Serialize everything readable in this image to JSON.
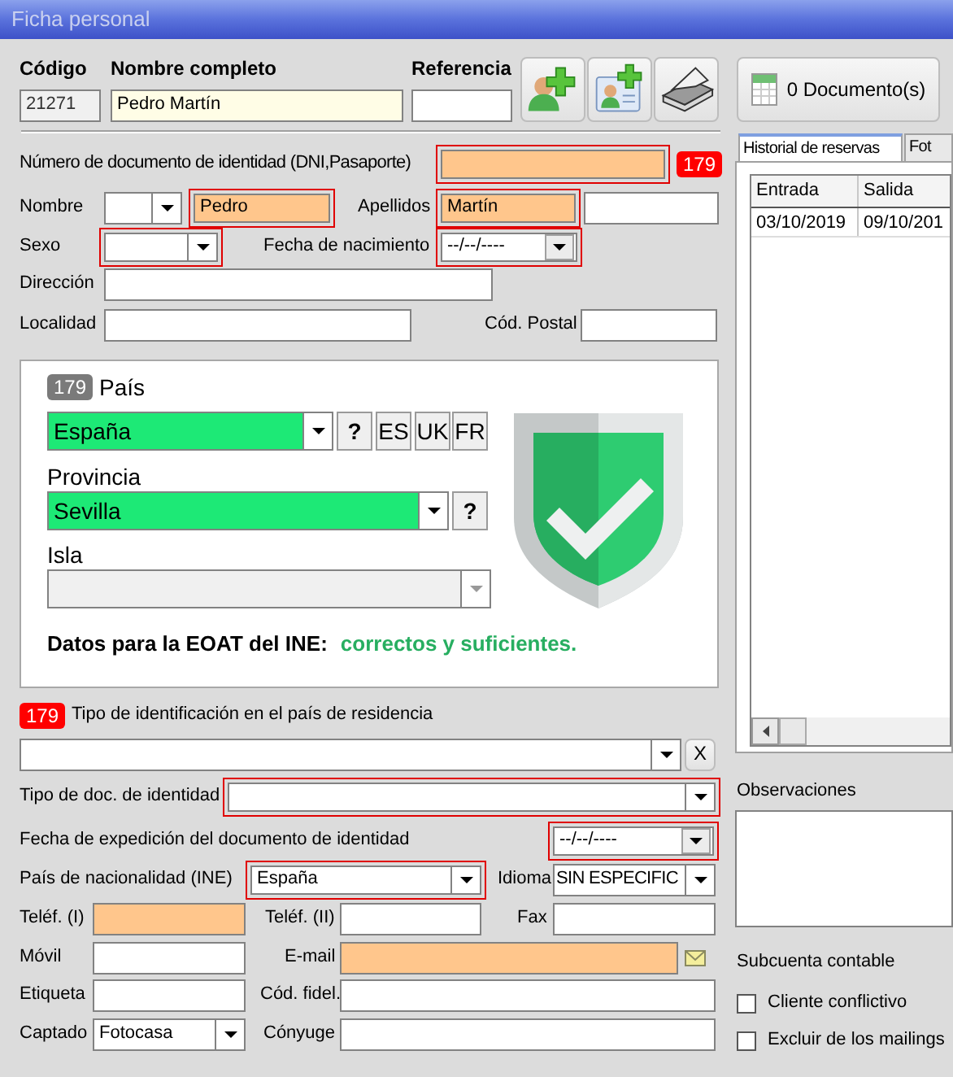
{
  "window": {
    "title": "Ficha personal"
  },
  "header": {
    "code": {
      "label": "Código",
      "value": "21271",
      "disabled": true
    },
    "full_name": {
      "label": "Nombre completo",
      "value": "Pedro Martín"
    },
    "reference": {
      "label": "Referencia"
    }
  },
  "documents_button": {
    "label": "0 Documento(s)"
  },
  "id_number": {
    "label": "Número de documento de identidad (DNI,Pasaporte)",
    "highlighted": true,
    "error": true,
    "badge": {
      "text": "179",
      "color": "#ff0000"
    }
  },
  "first_name": {
    "label": "Nombre",
    "value": "Pedro",
    "highlighted": true,
    "error": true
  },
  "surname": {
    "label": "Apellidos",
    "value": "Martín",
    "highlighted": true,
    "error": true
  },
  "sex": {
    "label": "Sexo",
    "error": true
  },
  "birth_date": {
    "label": "Fecha de nacimiento",
    "value": "--/--/----",
    "error": true
  },
  "address": {
    "label": "Dirección"
  },
  "city": {
    "label": "Localidad"
  },
  "postal_code": {
    "label": "Cód. Postal"
  },
  "location_panel": {
    "badge": {
      "text": "179",
      "color": "#7a7a7a"
    },
    "country": {
      "label": "País",
      "value": "España",
      "valid": true
    },
    "country_buttons": [
      "?",
      "ES",
      "UK",
      "FR"
    ],
    "province": {
      "label": "Provincia",
      "value": "Sevilla",
      "valid": true
    },
    "province_button": "?",
    "island": {
      "label": "Isla",
      "disabled": true
    },
    "eoat_label": "Datos para la EOAT del INE:",
    "eoat_status": "correctos y suficientes."
  },
  "residence_id": {
    "badge": {
      "text": "179",
      "color": "#ff0000"
    },
    "label": "Tipo de identificación en el país de residencia",
    "clear_button": "X"
  },
  "doc_type": {
    "label": "Tipo de doc. de identidad",
    "error": true
  },
  "issue_date": {
    "label": "Fecha de expedición del documento de identidad",
    "value": "--/--/----",
    "error": true
  },
  "nationality": {
    "label": "País de nacionalidad (INE)",
    "value": "España",
    "error": true
  },
  "language": {
    "label": "Idioma",
    "value": "SIN ESPECIFIC"
  },
  "phone_1": {
    "label": "Teléf. (I)",
    "highlighted": true
  },
  "phone_2": {
    "label": "Teléf. (II)"
  },
  "fax": {
    "label": "Fax"
  },
  "mobile": {
    "label": "Móvil"
  },
  "email": {
    "label": "E-mail",
    "highlighted": true
  },
  "tag": {
    "label": "Etiqueta"
  },
  "loyalty_code": {
    "label": "Cód. fidel."
  },
  "source": {
    "label": "Captado",
    "value": "Fotocasa"
  },
  "spouse": {
    "label": "Cónyuge"
  },
  "tabs": [
    {
      "label": "Historial de reservas",
      "selected": true
    },
    {
      "label": "Fot",
      "selected": false
    }
  ],
  "bookings": {
    "columns": [
      "Entrada",
      "Salida"
    ],
    "rows": [
      [
        "03/10/2019",
        "09/10/201"
      ]
    ]
  },
  "notes": {
    "label": "Observaciones"
  },
  "subaccount": {
    "label": "Subcuenta contable"
  },
  "options": [
    {
      "label": "Cliente conflictivo",
      "checked": false
    },
    {
      "label": "Excluir de los mailings",
      "checked": false
    }
  ]
}
